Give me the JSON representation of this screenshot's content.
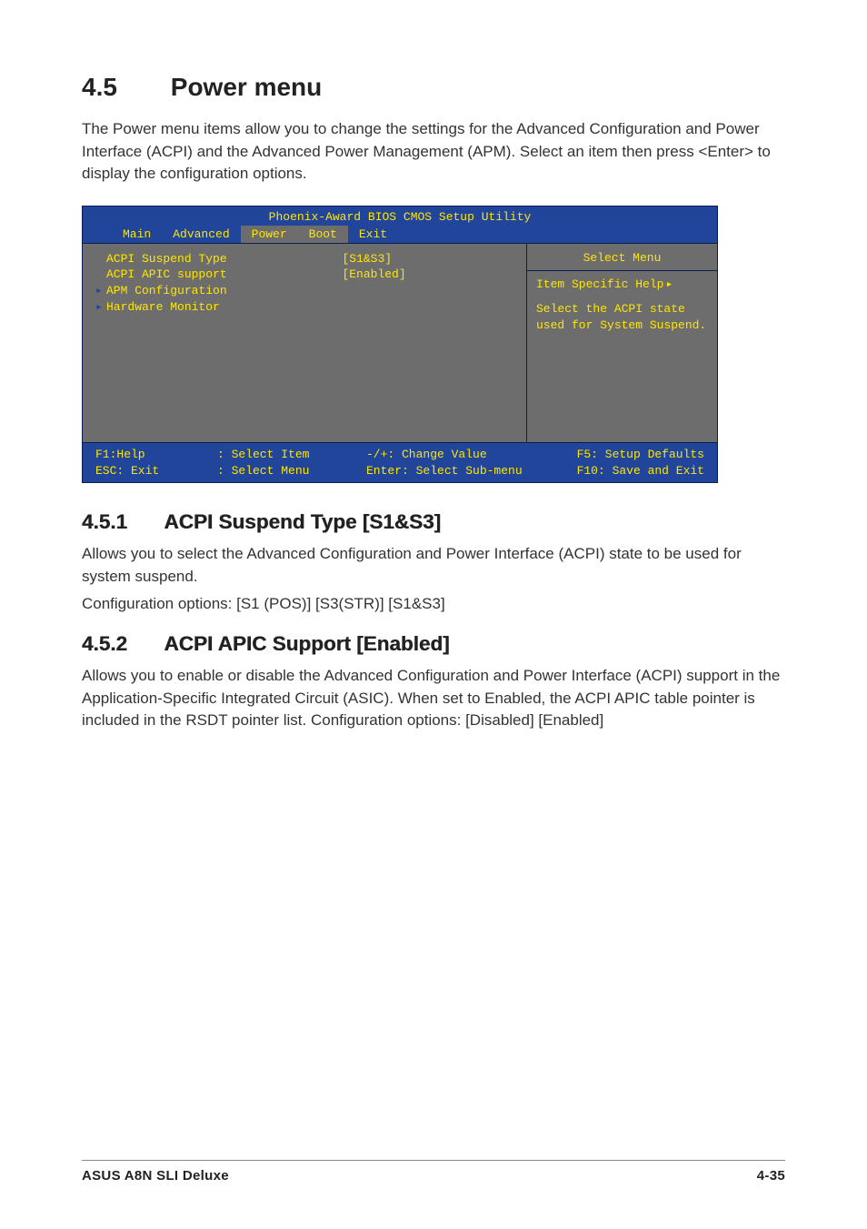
{
  "section": {
    "number": "4.5",
    "title": "Power menu"
  },
  "intro": "The Power menu items allow you to change the settings for the Advanced Configuration and Power Interface (ACPI) and the Advanced Power Management (APM). Select an item then press <Enter> to display the configuration options.",
  "bios": {
    "title": "Phoenix-Award BIOS CMOS Setup Utility",
    "tabs": {
      "main": "Main",
      "advanced": "Advanced",
      "power": "Power",
      "boot": "Boot",
      "exit": "Exit",
      "active": "Power"
    },
    "items": [
      {
        "label": "ACPI Suspend Type",
        "value": "[S1&S3]",
        "submenu": false
      },
      {
        "label": "ACPI APIC support",
        "value": "[Enabled]",
        "submenu": false
      },
      {
        "label": "APM Configuration",
        "value": "",
        "submenu": true
      },
      {
        "label": "Hardware Monitor",
        "value": "",
        "submenu": true
      }
    ],
    "help": {
      "title": "Select Menu",
      "header": "Item Specific Help",
      "body": "Select the ACPI state used for System Suspend."
    },
    "footer": {
      "c1a": "F1:Help",
      "c1b": "ESC: Exit",
      "c2a": ": Select Item",
      "c2b": ": Select Menu",
      "c3a": "-/+: Change Value",
      "c3b": "Enter: Select Sub-menu",
      "c4a": "F5: Setup Defaults",
      "c4b": "F10: Save and Exit"
    }
  },
  "sub1": {
    "number": "4.5.1",
    "title": "ACPI Suspend Type [S1&S3]",
    "para1": "Allows you to select the Advanced Configuration and Power Interface (ACPI) state to be used for system suspend.",
    "para2": "Configuration options: [S1 (POS)] [S3(STR)] [S1&S3]"
  },
  "sub2": {
    "number": "4.5.2",
    "title": "ACPI APIC Support [Enabled]",
    "para": "Allows you to enable or disable the Advanced Configuration and Power Interface (ACPI) support in the Application-Specific Integrated Circuit (ASIC). When set to Enabled, the ACPI APIC table pointer is included in the RSDT pointer list. Configuration options: [Disabled] [Enabled]"
  },
  "footer": {
    "product": "ASUS A8N SLI Deluxe",
    "page": "4-35"
  }
}
